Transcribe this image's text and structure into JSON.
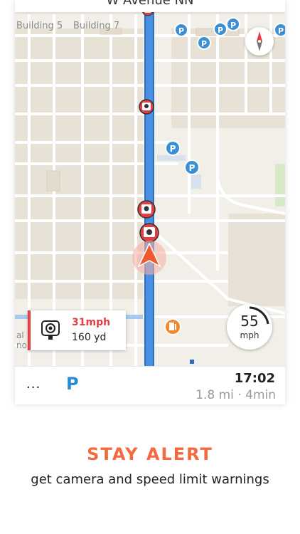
{
  "top_bar": {
    "street_name": "W Avenue NN"
  },
  "map": {
    "building_labels": [
      "Building 5",
      "Building 7"
    ],
    "street_fragments": [
      "al",
      "non"
    ],
    "parking_symbol": "P",
    "fuel_icon": "fuel-station-icon",
    "camera_icon": "speed-camera-icon",
    "route_color": "#4a90e2",
    "alert_color": "#e63c45"
  },
  "camera_warning": {
    "speed_limit": "31mph",
    "distance": "160 yd"
  },
  "speedometer": {
    "value": "55",
    "unit": "mph"
  },
  "bottom_bar": {
    "more_label": "...",
    "parking_label": "P",
    "eta_time": "17:02",
    "remaining": "1.8 mi · 4min"
  },
  "promo": {
    "headline": "STAY ALERT",
    "subtitle": "get camera and speed limit warnings"
  }
}
